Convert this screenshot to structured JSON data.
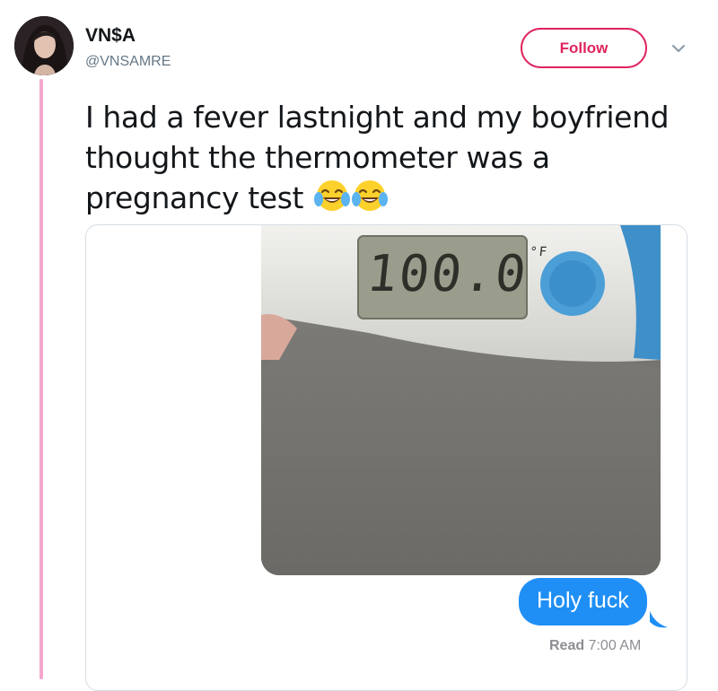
{
  "author": {
    "display_name": "VN$A",
    "handle": "@VNSAMRE"
  },
  "follow_button": {
    "label": "Follow"
  },
  "tweet": {
    "text": "I had a fever lastnight and my boyfriend thought the thermometer was a pregnancy test",
    "emoji": [
      "face-with-tears-of-joy",
      "face-with-tears-of-joy"
    ]
  },
  "screenshot": {
    "thermometer_reading": "100.0",
    "thermometer_unit": "°F",
    "message": "Holy fuck",
    "read_label": "Read",
    "read_time": "7:00 AM"
  },
  "colors": {
    "follow_accent": "#e0245e",
    "thread_line": "#f6a7cf",
    "imessage_blue": "#1f8ff5",
    "handle_gray": "#657786"
  }
}
